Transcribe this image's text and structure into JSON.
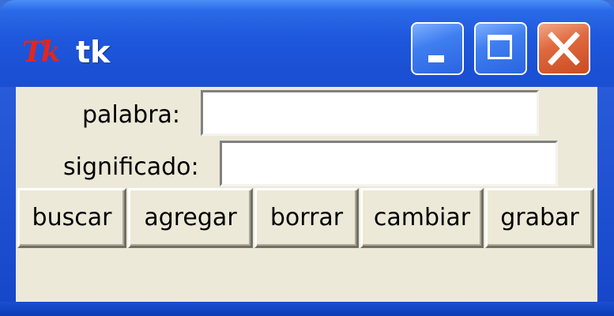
{
  "window": {
    "title": "tk",
    "logo_text": "Tk"
  },
  "form": {
    "palabra_label": "palabra:",
    "palabra_value": "",
    "significado_label": "significado:",
    "significado_value": ""
  },
  "buttons": {
    "buscar": "buscar",
    "agregar": "agregar",
    "borrar": "borrar",
    "cambiar": "cambiar",
    "grabar": "grabar"
  },
  "colors": {
    "titlebar": "#1e57dc",
    "client_bg": "#ece9d8",
    "close_button": "#e06a3f",
    "logo": "#e2261f"
  },
  "icons": {
    "app": "tk-feather-logo-icon",
    "minimize": "minimize-icon",
    "maximize": "maximize-icon",
    "close": "close-icon"
  }
}
